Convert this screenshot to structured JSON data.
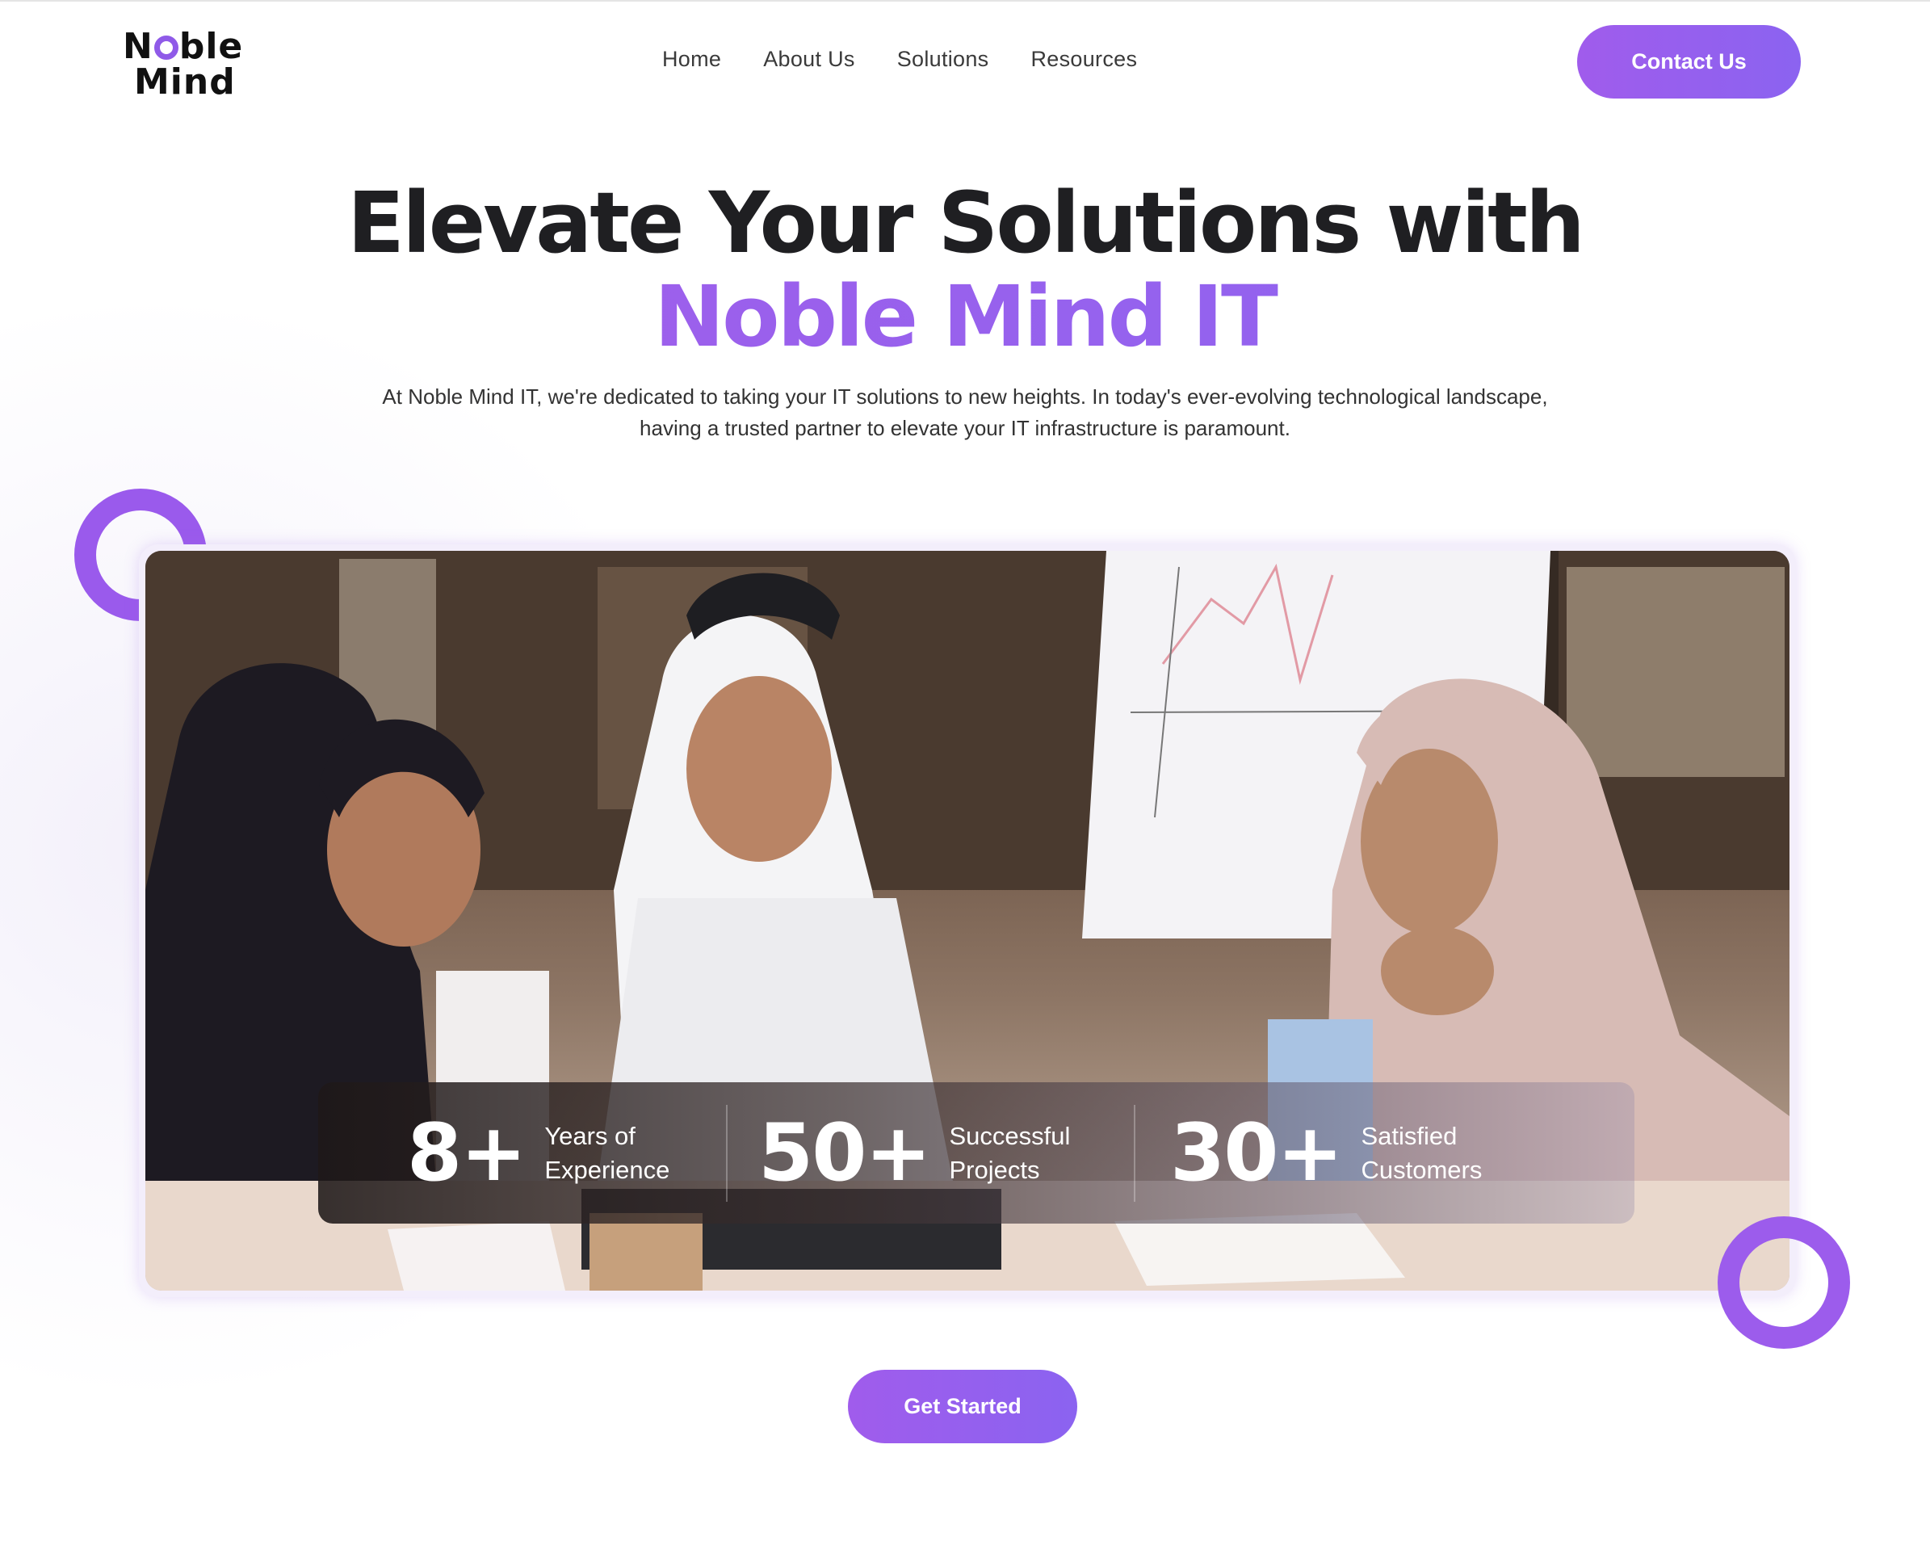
{
  "brand": {
    "logo_line1": "Noble",
    "logo_line2": "Mind"
  },
  "nav": {
    "items": [
      "Home",
      "About Us",
      "Solutions",
      "Resources"
    ]
  },
  "header": {
    "contact_label": "Contact Us"
  },
  "hero": {
    "title_line1": "Elevate Your Solutions with",
    "title_line2": "Noble Mind IT",
    "subtitle_line1": "At Noble Mind IT, we're dedicated to taking your IT solutions to new heights. In today's ever-evolving technological landscape,",
    "subtitle_line2": "having a trusted partner to elevate your IT infrastructure is paramount."
  },
  "stats": [
    {
      "value": "8+",
      "label_line1": "Years of",
      "label_line2": "Experience"
    },
    {
      "value": "50+",
      "label_line1": "Successful",
      "label_line2": "Projects"
    },
    {
      "value": "30+",
      "label_line1": "Satisfied",
      "label_line2": "Customers"
    }
  ],
  "cta": {
    "label": "Get Started"
  },
  "colors": {
    "accent": "#9a5aec",
    "accent_end": "#8b63f0",
    "text_dark": "#1f1f22"
  }
}
